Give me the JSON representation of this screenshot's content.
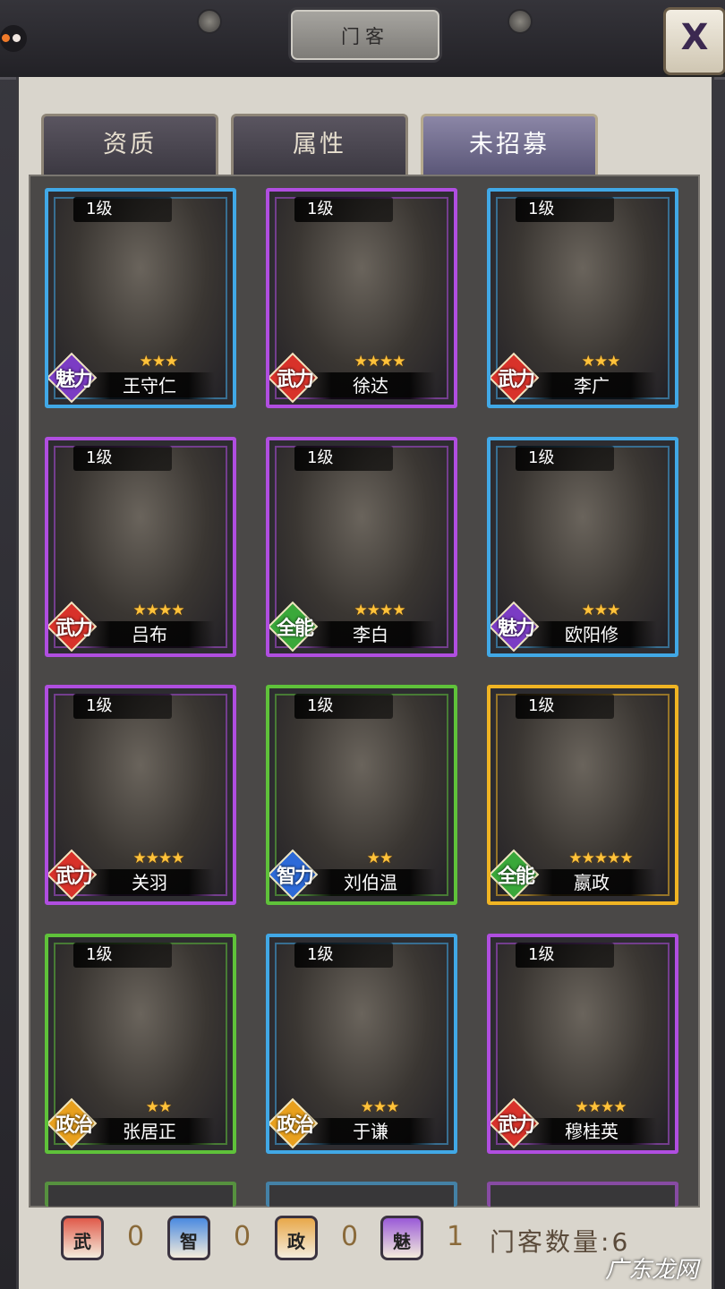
{
  "window": {
    "title": "门客",
    "close_label": "X"
  },
  "tabs": [
    {
      "label": "资质",
      "active": false
    },
    {
      "label": "属性",
      "active": false
    },
    {
      "label": "未招募",
      "active": true
    }
  ],
  "cards": [
    {
      "level": "1级",
      "name": "王守仁",
      "stars": "★★★",
      "attribute": "魅力",
      "border": "#41a8e6",
      "badge_color": "#7b3cc4"
    },
    {
      "level": "1级",
      "name": "徐达",
      "stars": "★★★★",
      "attribute": "武力",
      "border": "#b04ee0",
      "badge_color": "#d8322a"
    },
    {
      "level": "1级",
      "name": "李广",
      "stars": "★★★",
      "attribute": "武力",
      "border": "#41a8e6",
      "badge_color": "#d8322a"
    },
    {
      "level": "1级",
      "name": "吕布",
      "stars": "★★★★",
      "attribute": "武力",
      "border": "#b04ee0",
      "badge_color": "#d8322a"
    },
    {
      "level": "1级",
      "name": "李白",
      "stars": "★★★★",
      "attribute": "全能",
      "border": "#b04ee0",
      "badge_color": "#3aa83a"
    },
    {
      "level": "1级",
      "name": "欧阳修",
      "stars": "★★★",
      "attribute": "魅力",
      "border": "#41a8e6",
      "badge_color": "#7b3cc4"
    },
    {
      "level": "1级",
      "name": "关羽",
      "stars": "★★★★",
      "attribute": "武力",
      "border": "#b04ee0",
      "badge_color": "#d8322a"
    },
    {
      "level": "1级",
      "name": "刘伯温",
      "stars": "★★",
      "attribute": "智力",
      "border": "#5fc23a",
      "badge_color": "#2d6ad8"
    },
    {
      "level": "1级",
      "name": "嬴政",
      "stars": "★★★★★",
      "attribute": "全能",
      "border": "#f0b423",
      "badge_color": "#3aa83a"
    },
    {
      "level": "1级",
      "name": "张居正",
      "stars": "★★",
      "attribute": "政治",
      "border": "#5fc23a",
      "badge_color": "#e8a01e"
    },
    {
      "level": "1级",
      "name": "于谦",
      "stars": "★★★",
      "attribute": "政治",
      "border": "#41a8e6",
      "badge_color": "#e8a01e"
    },
    {
      "level": "1级",
      "name": "穆桂英",
      "stars": "★★★★",
      "attribute": "武力",
      "border": "#b04ee0",
      "badge_color": "#d8322a"
    }
  ],
  "resources": [
    {
      "label": "武",
      "count": "0",
      "color": "#e05a4a",
      "icon": "scroll-icon-strength"
    },
    {
      "label": "智",
      "count": "0",
      "color": "#4a8ae0",
      "icon": "scroll-icon-intellect"
    },
    {
      "label": "政",
      "count": "0",
      "color": "#e8a84a",
      "icon": "scroll-icon-politics"
    },
    {
      "label": "魅",
      "count": "1",
      "color": "#9a5ad8",
      "icon": "scroll-icon-charm"
    }
  ],
  "footer": {
    "total_label": "门客数量:",
    "total_value": "6"
  },
  "watermark": "广东龙网"
}
